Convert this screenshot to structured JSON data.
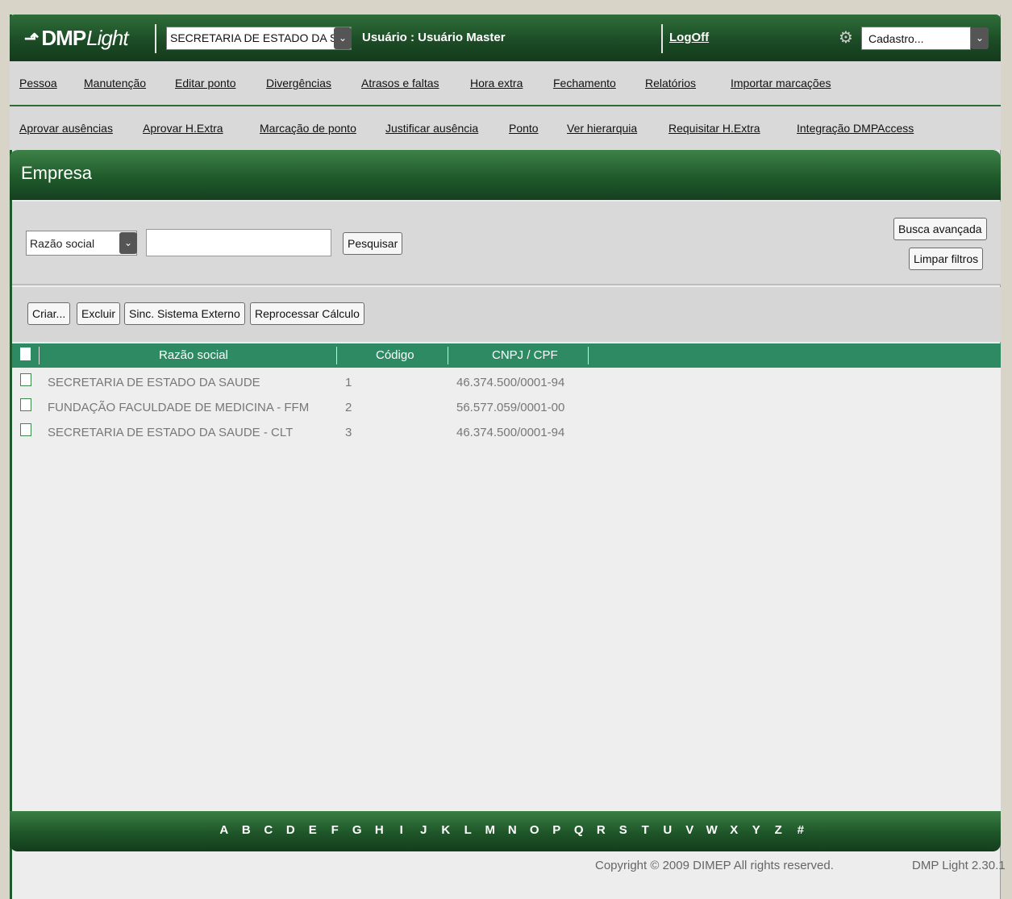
{
  "header": {
    "logo_bold": "DMP",
    "logo_light": "Light",
    "company_selected": "SECRETARIA DE ESTADO DA SAU",
    "user_label": "Usuário : Usuário Master",
    "logoff": "LogOff",
    "cadastro": "Cadastro..."
  },
  "menu_row1": [
    "Pessoa",
    "Manutenção",
    "Editar ponto",
    "Divergências",
    "Atrasos e faltas",
    "Hora extra",
    "Fechamento",
    "Relatórios",
    "Importar marcações"
  ],
  "menu_row2": [
    "Aprovar ausências",
    "Aprovar H.Extra",
    "Marcação de ponto",
    "Justificar ausência",
    "Ponto",
    "Ver hierarquia",
    "Requisitar H.Extra",
    "Integração DMPAccess"
  ],
  "page_title": "Empresa",
  "search": {
    "field": "Razão social",
    "value": "",
    "search_button": "Pesquisar",
    "advanced_button": "Busca avançada",
    "clear_button": "Limpar filtros"
  },
  "actions": {
    "create": "Criar...",
    "delete": "Excluir",
    "sync": "Sinc. Sistema Externo",
    "reprocess": "Reprocessar Cálculo"
  },
  "table": {
    "columns": [
      "Razão social",
      "Código",
      "CNPJ / CPF"
    ],
    "rows": [
      {
        "name": "SECRETARIA DE ESTADO DA SAUDE",
        "code": "1",
        "cnpj": "46.374.500/0001-94"
      },
      {
        "name": "FUNDAÇÃO FACULDADE DE MEDICINA - FFM",
        "code": "2",
        "cnpj": "56.577.059/0001-00"
      },
      {
        "name": "SECRETARIA DE ESTADO DA SAUDE - CLT",
        "code": "3",
        "cnpj": "46.374.500/0001-94"
      }
    ]
  },
  "alphabet": [
    "A",
    "B",
    "C",
    "D",
    "E",
    "F",
    "G",
    "H",
    "I",
    "J",
    "K",
    "L",
    "M",
    "N",
    "O",
    "P",
    "Q",
    "R",
    "S",
    "T",
    "U",
    "V",
    "W",
    "X",
    "Y",
    "Z",
    "#"
  ],
  "footer": {
    "copyright": "Copyright © 2009 DIMEP All rights reserved.",
    "version": "DMP Light 2.30.1"
  },
  "colors": {
    "header_green": "#1b4a24",
    "table_header": "#2e8a63"
  }
}
